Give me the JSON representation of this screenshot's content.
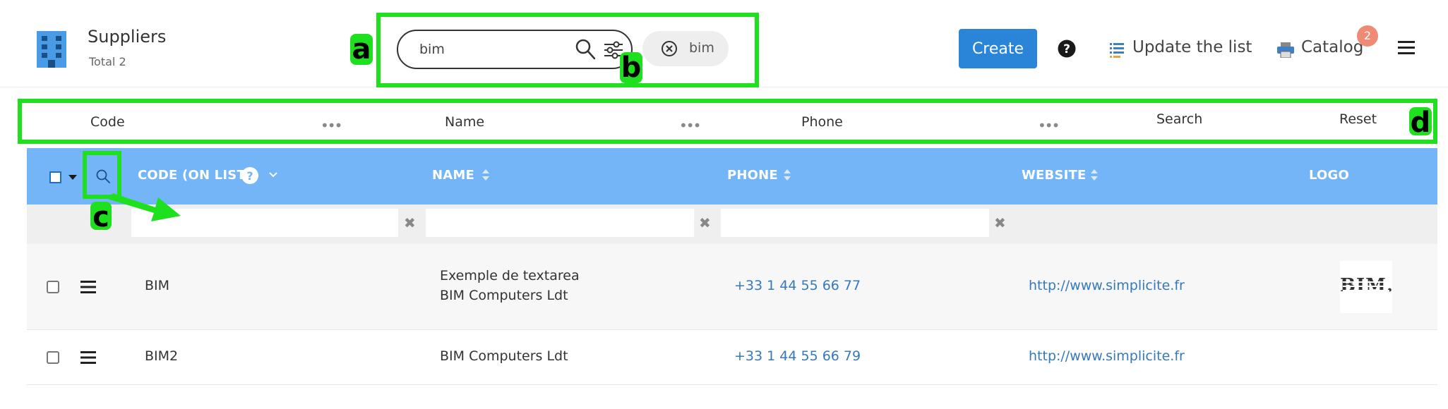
{
  "header": {
    "app_title": "Suppliers",
    "app_subtitle": "Total 2",
    "search_value": "bim",
    "active_filter_chip": "bim",
    "create_label": "Create",
    "update_list_label": "Update the list",
    "catalog_label": "Catalog",
    "catalog_badge": "2",
    "icons": [
      "building-icon",
      "search-icon",
      "filter-settings-icon",
      "circle-x-icon",
      "help-icon",
      "list-icon",
      "printer-icon",
      "hamburger-menu-icon"
    ]
  },
  "filter_bar": {
    "fields": [
      "Code",
      "Name",
      "Phone"
    ],
    "more": "•••",
    "search_label": "Search",
    "reset_label": "Reset"
  },
  "table": {
    "columns": [
      "CODE (ON LIST)",
      "NAME",
      "PHONE",
      "WEBSITE",
      "LOGO"
    ],
    "clear_glyph": "✖",
    "rows": [
      {
        "code": "BIM",
        "name_line1": "Exemple de textarea",
        "name_line2": "BIM Computers Ldt",
        "phone": "+33 1 44 55 66 77",
        "website": "http://www.simplicite.fr",
        "logo_text": "BIM."
      },
      {
        "code": "BIM2",
        "name_line1": "BIM Computers Ldt",
        "phone": "+33 1 44 55 66 79",
        "website": "http://www.simplicite.fr"
      }
    ]
  },
  "annotations": {
    "a": "a",
    "b": "b",
    "c": "c",
    "d": "d"
  },
  "colors": {
    "primary": "#2a85d8",
    "table_header": "#73b5f7",
    "link": "#3479bd",
    "badge": "#ef8a74",
    "annotation": "#1ee01e"
  }
}
